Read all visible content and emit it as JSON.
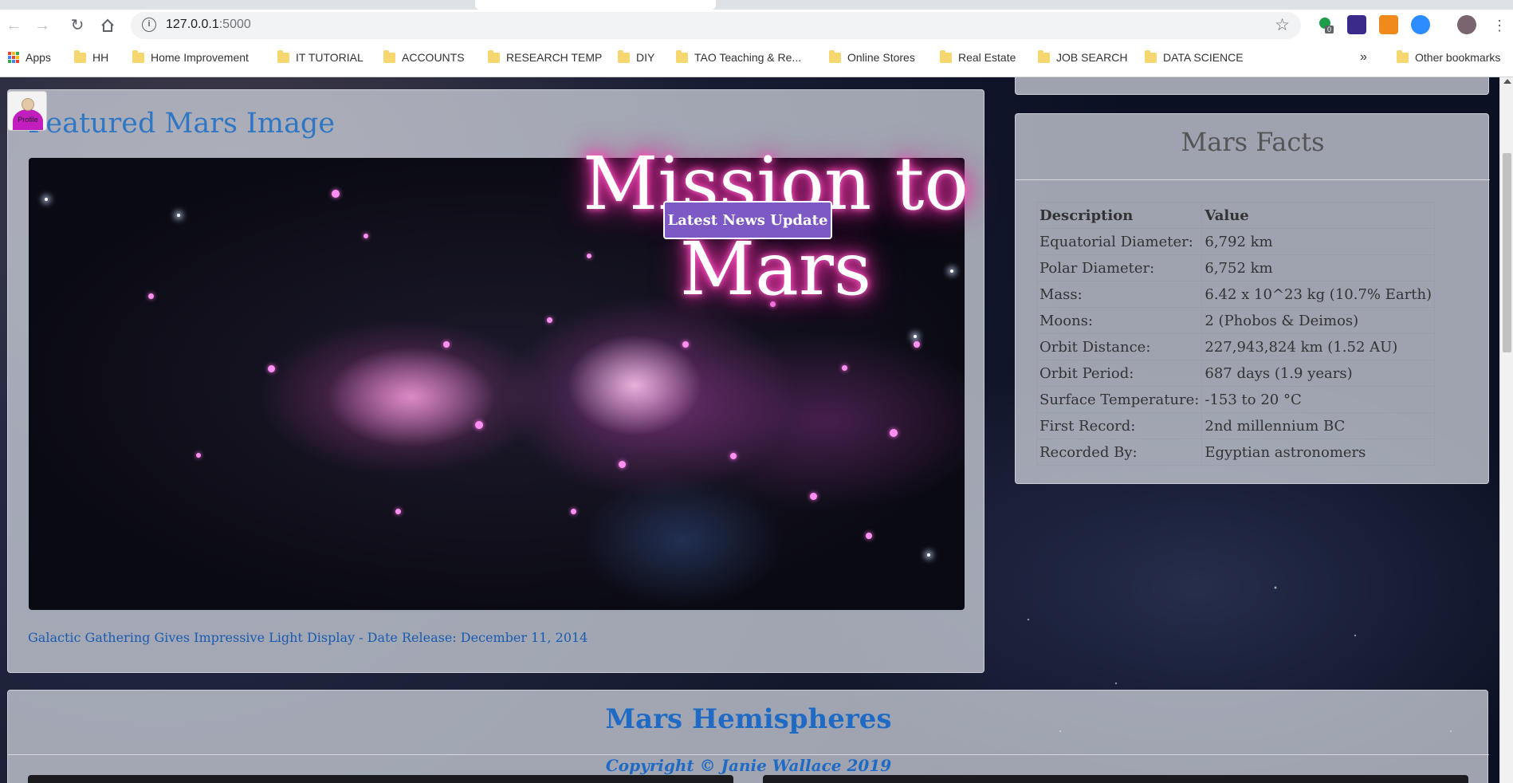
{
  "browser": {
    "url_host": "127.0.0.1",
    "url_port": ":5000",
    "ext_badge": "0",
    "bookmarks": [
      {
        "label": "Apps",
        "kind": "apps"
      },
      {
        "label": "HH",
        "kind": "folder"
      },
      {
        "label": "Home Improvement",
        "kind": "folder"
      },
      {
        "label": "IT TUTORIAL",
        "kind": "folder"
      },
      {
        "label": "ACCOUNTS",
        "kind": "folder"
      },
      {
        "label": "RESEARCH TEMP",
        "kind": "folder"
      },
      {
        "label": "DIY",
        "kind": "folder"
      },
      {
        "label": "TAO Teaching & Re...",
        "kind": "folder"
      },
      {
        "label": "Online Stores",
        "kind": "folder"
      },
      {
        "label": "Real Estate",
        "kind": "folder"
      },
      {
        "label": "JOB SEARCH",
        "kind": "folder"
      },
      {
        "label": "DATA SCIENCE",
        "kind": "folder"
      }
    ],
    "overflow": "»",
    "other_bookmarks": "Other bookmarks"
  },
  "page": {
    "profile_label": "Profile",
    "jumbotron_title": "Mission to Mars",
    "news_button": "Latest News Update",
    "featured": {
      "heading": "Featured Mars Image",
      "caption": "Galactic Gathering Gives Impressive Light Display - Date Release: December 11, 2014"
    },
    "facts": {
      "heading": "Mars Facts",
      "columns": [
        "Description",
        "Value"
      ],
      "rows": [
        [
          "Equatorial Diameter:",
          "6,792 km"
        ],
        [
          "Polar Diameter:",
          "6,752 km"
        ],
        [
          "Mass:",
          "6.42 x 10^23 kg (10.7% Earth)"
        ],
        [
          "Moons:",
          "2 (Phobos & Deimos)"
        ],
        [
          "Orbit Distance:",
          "227,943,824 km (1.52 AU)"
        ],
        [
          "Orbit Period:",
          "687 days (1.9 years)"
        ],
        [
          "Surface Temperature:",
          "-153 to 20 °C"
        ],
        [
          "First Record:",
          "2nd millennium BC"
        ],
        [
          "Recorded By:",
          "Egyptian astronomers"
        ]
      ]
    },
    "hemispheres": {
      "heading": "Mars Hemispheres"
    },
    "copyright": "Copyright © Janie Wallace 2019"
  },
  "colors": {
    "accent_blue": "#1e6ac4",
    "button_purple": "#7c59c4",
    "glow_pink": "#ff3fb5"
  }
}
